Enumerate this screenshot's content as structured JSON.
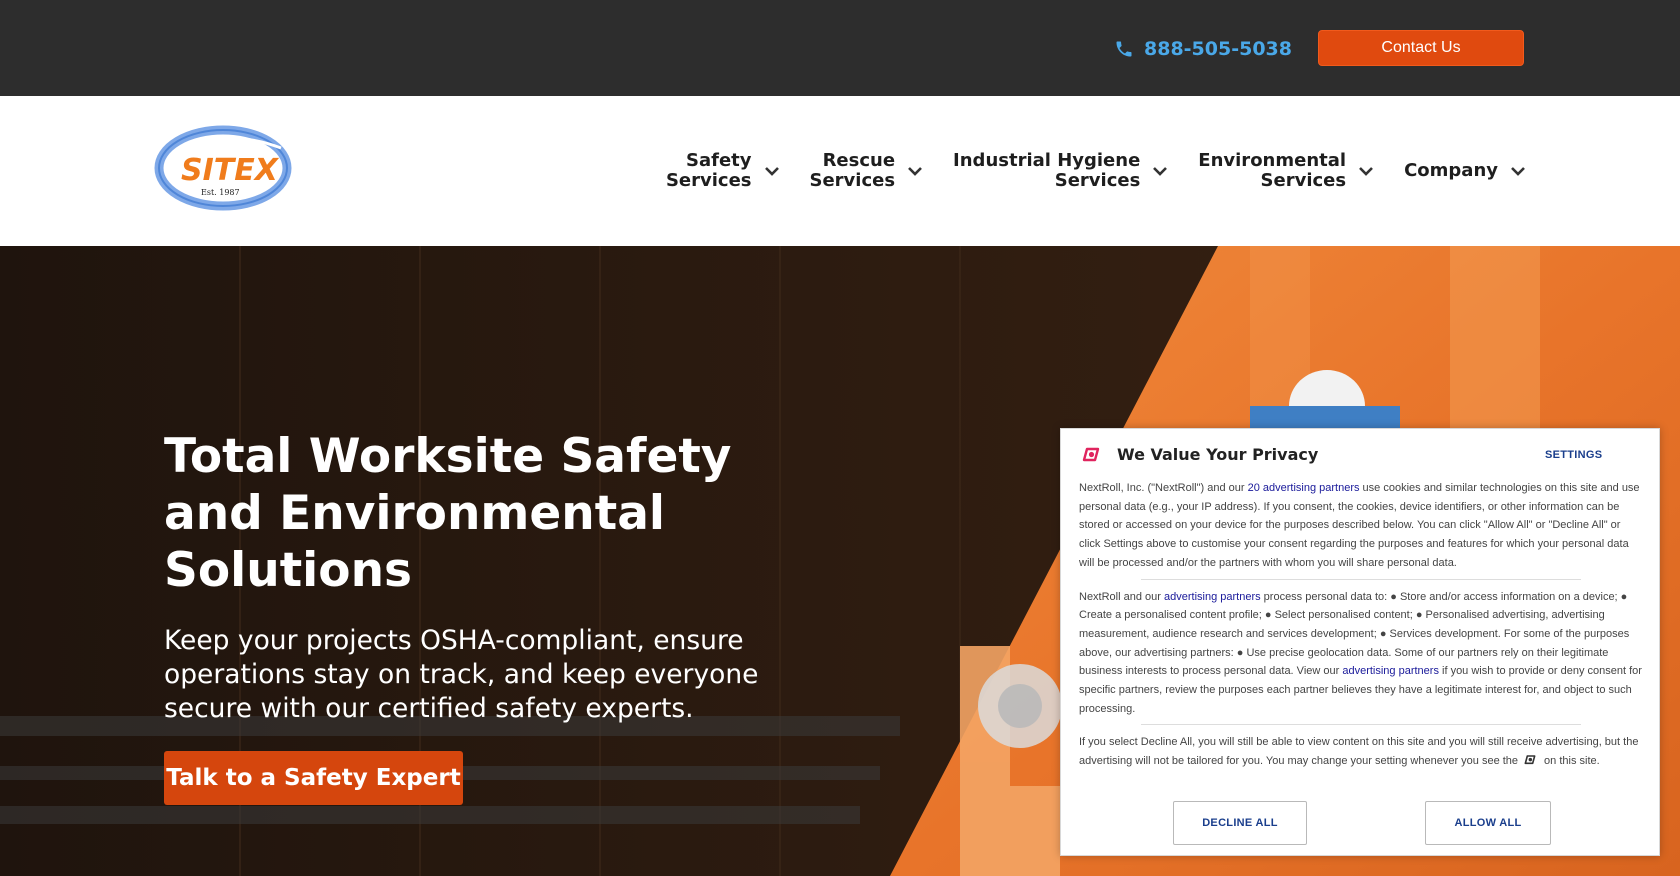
{
  "topbar": {
    "phone": "888-505-5038",
    "contact_label": "Contact Us"
  },
  "header": {
    "logo_text": "SITEX",
    "logo_est": "Est. 1987",
    "nav": [
      {
        "line1": "Safety",
        "line2": "Services"
      },
      {
        "line1": "Rescue",
        "line2": "Services"
      },
      {
        "line1": "Industrial Hygiene",
        "line2": "Services"
      },
      {
        "line1": "Environmental",
        "line2": "Services"
      },
      {
        "line1": "Company",
        "line2": ""
      }
    ]
  },
  "hero": {
    "title": "Total Worksite Safety and Environmental Solutions",
    "subtitle": "Keep your projects OSHA-compliant, ensure operations stay on track, and keep everyone secure with our certified safety experts.",
    "cta": "Talk to a Safety Expert"
  },
  "privacy": {
    "title": "We Value Your Privacy",
    "settings": "SETTINGS",
    "p1_a": "NextRoll, Inc. (\"NextRoll\") and our ",
    "p1_link": "20 advertising partners",
    "p1_b": " use cookies and similar technologies on this site and use personal data (e.g., your IP address). If you consent, the cookies, device identifiers, or other information can be stored or accessed on your device for the purposes described below. You can click \"Allow All\" or \"Decline All\" or click Settings above to customise your consent regarding the purposes and features for which your personal data will be processed and/or the partners with whom you will share personal data.",
    "p2_a": "NextRoll and our ",
    "p2_link1": "advertising partners",
    "p2_b": " process personal data to: ● Store and/or access information on a device; ● Create a personalised content profile; ● Select personalised content; ● Personalised advertising, advertising measurement, audience research and services development; ● Services development. For some of the purposes above, our advertising partners: ● Use precise geolocation data. Some of our partners rely on their legitimate business interests to process personal data. View our ",
    "p2_link2": "advertising partners",
    "p2_c": " if you wish to provide or deny consent for specific partners, review the purposes each partner believes they have a legitimate interest for, and object to such processing.",
    "p3_a": "If you select Decline All, you will still be able to view content on this site and you will still receive advertising, but the advertising will not be tailored for you. You may change your setting whenever you see the",
    "p3_b": "on this site.",
    "decline": "DECLINE ALL",
    "allow": "ALLOW ALL"
  },
  "colors": {
    "topbar_bg": "#2d2d2d",
    "accent_orange": "#e04a0f",
    "phone_blue": "#4aa8e8",
    "link_blue": "#1a3e8c"
  },
  "icons": {
    "phone": "phone-icon",
    "chevron": "chevron-down-icon",
    "nextroll": "nextroll-icon"
  }
}
